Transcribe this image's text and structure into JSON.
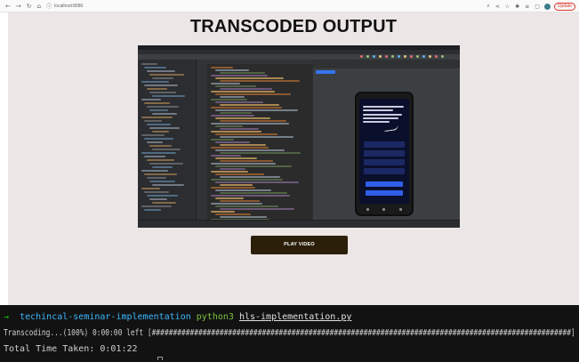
{
  "browser": {
    "url": "localhost:8080",
    "update_label": "Update",
    "nav_icons": [
      "back-arrow-icon",
      "forward-arrow-icon",
      "reload-icon",
      "home-icon"
    ],
    "toolbar_icons": [
      "zoom-icon",
      "share-icon",
      "star-icon",
      "extension-icon",
      "media-icon",
      "tab-icon"
    ]
  },
  "page": {
    "title": "TRANSCODED OUTPUT",
    "play_button_label": "PLAY VIDEO",
    "colors": {
      "page_bg": "#ede6e6",
      "button_bg": "#2b1f0a",
      "button_text": "#ffffff"
    }
  },
  "terminal": {
    "prompt_arrow": "→",
    "directory": "techincal-seminar-implementation",
    "command": "python3",
    "script": "hls-implementation.py",
    "progress_line": "Transcoding...(100%) 0:00:00 left [###################################################################################################]",
    "total_time_line": "Total Time Taken: 0:01:22",
    "colors": {
      "bg": "#121212",
      "arrow": "#16c60c",
      "directory": "#3bb8ff",
      "command": "#7ac23c"
    }
  }
}
